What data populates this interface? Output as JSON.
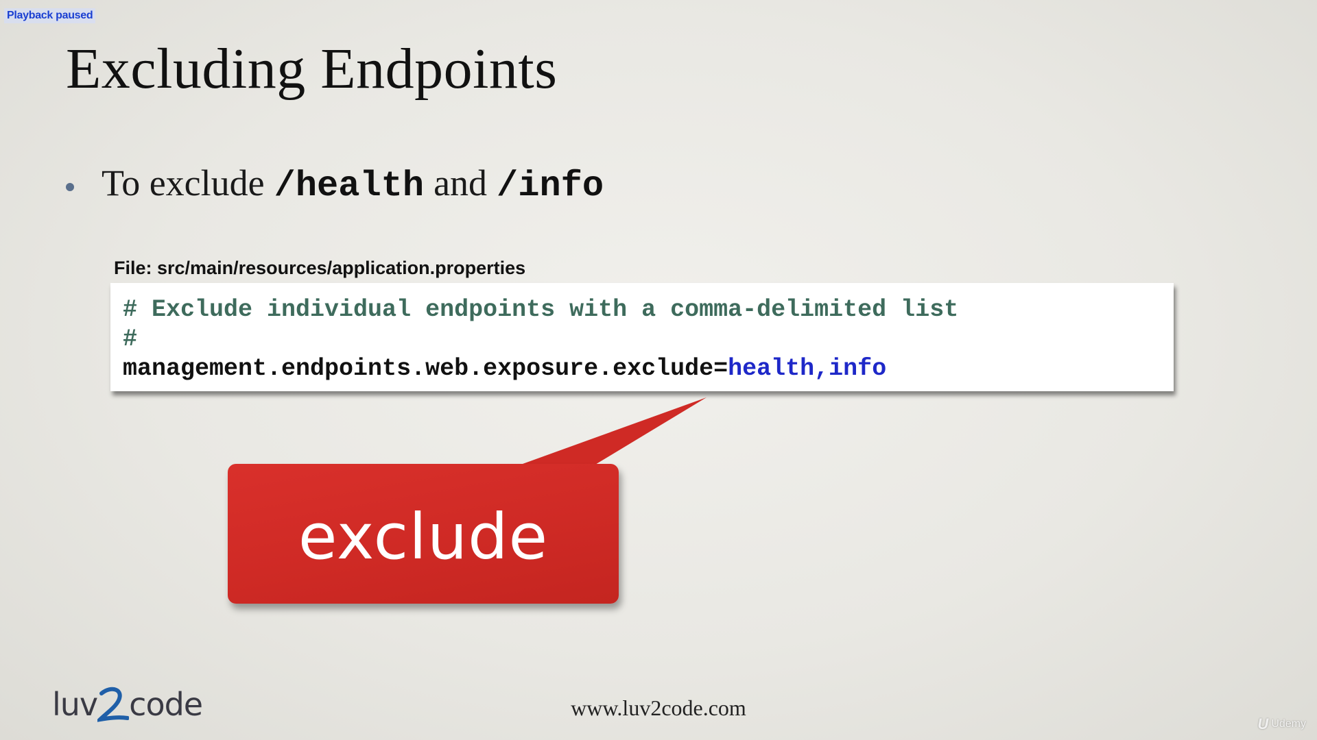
{
  "player": {
    "status_text": "Playback paused"
  },
  "slide": {
    "title": "Excluding Endpoints",
    "bullet": {
      "prefix": "To exclude",
      "endpoint_1": "/health",
      "conjunction": "and",
      "endpoint_2": "/info"
    },
    "file_label": "File: src/main/resources/application.properties",
    "code": {
      "line_1": "# Exclude individual endpoints with a comma-delimited list",
      "line_2": "#",
      "line_3_key": "management.endpoints.web.exposure.exclude=",
      "line_3_value": "health,info"
    },
    "callout_text": "exclude",
    "callout_color": "#d32a25",
    "code_comment_color": "#3e6b5c",
    "code_value_color": "#1e28c8",
    "footer": {
      "logo_text_1": "luv",
      "logo_text_2": "code",
      "logo_mark": "2",
      "url": "www.luv2code.com"
    },
    "watermark": {
      "mark": "U",
      "text": "Udemy"
    }
  }
}
